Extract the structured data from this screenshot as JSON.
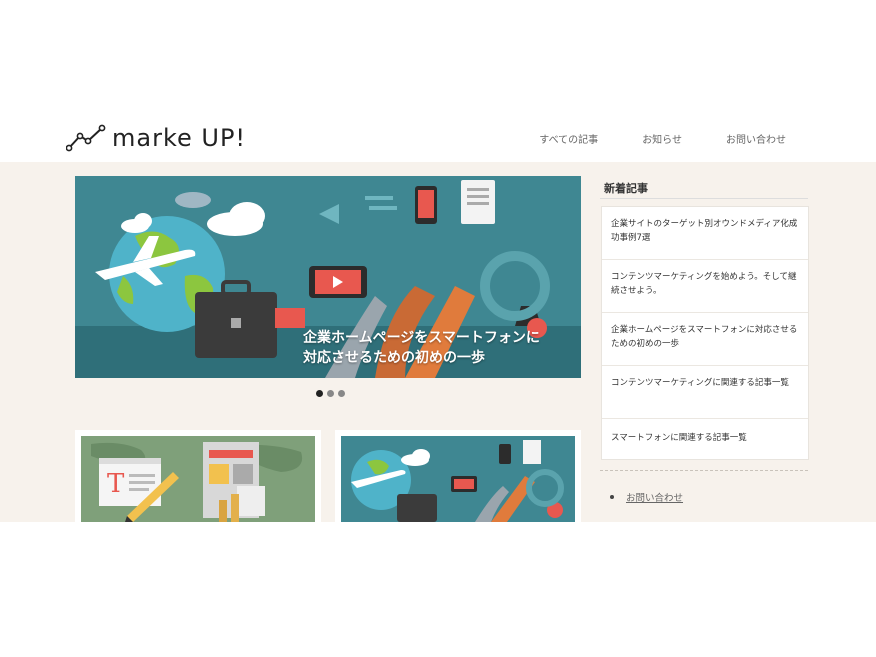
{
  "site": {
    "logo_text": "marke UP!"
  },
  "nav": {
    "items": [
      {
        "label": "すべての記事"
      },
      {
        "label": "お知らせ"
      },
      {
        "label": "お問い合わせ"
      }
    ]
  },
  "slider": {
    "caption_line1": "企業ホームページをスマートフォンに",
    "caption_line2": "対応させるための初めの一歩",
    "dots": 3,
    "active_dot": 0
  },
  "sidebar": {
    "title": "新着記事",
    "items": [
      {
        "label": "企業サイトのターゲット別オウンドメディア化成功事例7選"
      },
      {
        "label": "コンテンツマーケティングを始めよう。そして継続させよう。"
      },
      {
        "label": "企業ホームページをスマートフォンに対応させるための初めの一歩"
      },
      {
        "label": "コンテンツマーケティングに関連する記事一覧"
      },
      {
        "label": "スマートフォンに関連する記事一覧"
      }
    ],
    "contact_link": "お問い合わせ"
  },
  "colors": {
    "band_bg": "#f7f2ec",
    "slide_bg": "#3f8792",
    "card1_bg": "#7fa07a",
    "card2_bg": "#3f8792"
  },
  "icons": [
    "logo-chart-icon",
    "airplane-icon",
    "briefcase-icon",
    "cloud-icon",
    "globe-icon",
    "pencil-icon",
    "document-icon"
  ]
}
